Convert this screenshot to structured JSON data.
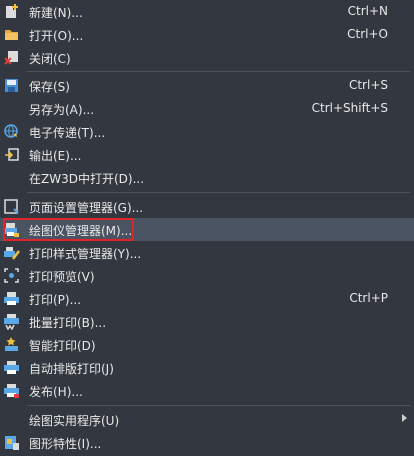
{
  "menu": {
    "items": [
      {
        "label": "新建(N)...",
        "shortcut": "Ctrl+N",
        "icon": "new-file-icon"
      },
      {
        "label": "打开(O)...",
        "shortcut": "Ctrl+O",
        "icon": "open-folder-icon"
      },
      {
        "label": "关闭(C)",
        "shortcut": "",
        "icon": "close-file-icon"
      },
      {
        "label": "保存(S)",
        "shortcut": "Ctrl+S",
        "icon": "save-icon"
      },
      {
        "label": "另存为(A)...",
        "shortcut": "Ctrl+Shift+S",
        "icon": ""
      },
      {
        "label": "电子传递(T)...",
        "shortcut": "",
        "icon": "etransmit-globe-icon"
      },
      {
        "label": "输出(E)...",
        "shortcut": "",
        "icon": "export-icon"
      },
      {
        "label": "在ZW3D中打开(D)...",
        "shortcut": "",
        "icon": ""
      },
      {
        "label": "页面设置管理器(G)...",
        "shortcut": "",
        "icon": "page-setup-icon"
      },
      {
        "label": "绘图仪管理器(M)...",
        "shortcut": "",
        "icon": "plotter-manager-icon"
      },
      {
        "label": "打印样式管理器(Y)...",
        "shortcut": "",
        "icon": "plot-style-icon"
      },
      {
        "label": "打印预览(V)",
        "shortcut": "",
        "icon": "print-preview-icon"
      },
      {
        "label": "打印(P)...",
        "shortcut": "Ctrl+P",
        "icon": "printer-icon"
      },
      {
        "label": "批量打印(B)...",
        "shortcut": "",
        "icon": "batch-print-icon"
      },
      {
        "label": "智能打印(D)",
        "shortcut": "",
        "icon": "smart-print-icon"
      },
      {
        "label": "自动排版打印(J)",
        "shortcut": "",
        "icon": "auto-layout-print-icon"
      },
      {
        "label": "发布(H)...",
        "shortcut": "",
        "icon": "publish-icon"
      },
      {
        "label": "绘图实用程序(U)",
        "shortcut": "",
        "icon": ""
      },
      {
        "label": "图形特性(I)...",
        "shortcut": "",
        "icon": "drawing-properties-icon"
      }
    ],
    "highlighted_index": 9,
    "colors": {
      "background": "#333840",
      "highlight": "#4a5361",
      "annotation_box": "#e0252a",
      "text": "#e8e8e8"
    }
  }
}
